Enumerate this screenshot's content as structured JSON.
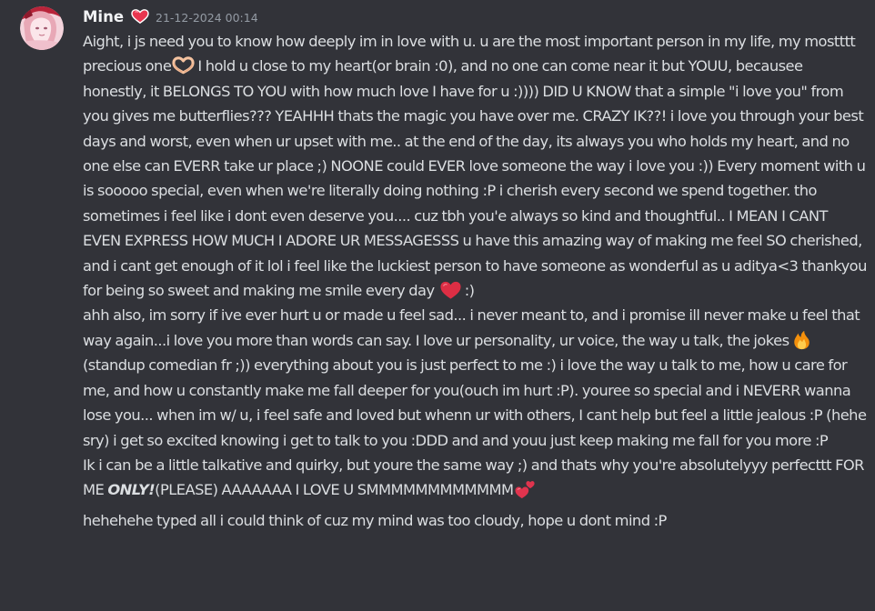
{
  "message": {
    "username": "Mine",
    "timestamp": "21-12-2024 00:14",
    "badge_icon": "red-heart-badge-icon",
    "colors": {
      "background": "#323339",
      "text": "#dbdee1",
      "username": "#f2f3f5",
      "timestamp": "#949ba4"
    },
    "p1": {
      "t1": "Aight, i js need you to know how deeply im in love with u. u are the most important person in my life, my mostttt precious one",
      "t2": "I hold u close to my heart(or brain :0), and no one can come near it but YOUU, becausee honestly, it BELONGS TO YOU with how much love I have for u :)))) DID U KNOW that a simple \"i love you\" from you gives me butterflies??? YEAHHH thats the magic you have over me. CRAZY IK??! i love you through your best days and worst, even when ur upset with me.. at the end of the day, its always you who holds my heart, and no one else can EVERR take ur place ;)  NOONE could EVER love someone the way i love you :)) Every moment with u is sooooo special, even when we're literally doing nothing :P i cherish every second we spend together. tho sometimes i feel like i dont even deserve you.... cuz tbh you'e always so kind and thoughtful.. I MEAN I CANT EVEN EXPRESS HOW MUCH I ADORE UR MESSAGESSS u have this amazing way of making me feel SO cherished, and i cant get enough of it lol i feel like the luckiest person to have someone as wonderful as u aditya<3 thankyou for being so sweet and making me smile every day",
      "t3": ":)"
    },
    "p2": {
      "t1": "ahh also, im sorry if ive ever hurt u or made u feel sad... i never meant to, and i promise ill never make u feel that way again...i love you more than words can say. I love ur personality, ur voice, the way u talk, the jokes",
      "t2": "(standup comedian fr ;)) everything about you is just perfect to me :) i love the way u talk to me, how u care for me, and how u constantly make me fall deeper for you(ouch im hurt :P). youree so special and i NEVERR wanna lose you... when im w/ u, i feel safe and loved but whenn ur with others, I cant help but feel a little jealous :P (hehe sry) i get so excited knowing i get to talk to you :DDD and and youu just keep making me fall for you more :P"
    },
    "p3": {
      "t1": "Ik i can be a little talkative and quirky, but youre the same way ;) and thats why you're absolutelyyy perfecttt FOR ME ",
      "t2": "ONLY!",
      "t3": "(PLEASE) AAAAAAA I LOVE U SMMMMMMMMMMMM"
    },
    "p4": {
      "t1": "hehehehe typed all i could think of cuz my mind was too cloudy, hope u dont mind :P"
    },
    "emojis": {
      "e1": "heart-hands-icon",
      "e2": "red-heart-icon",
      "e3": "fire-icon",
      "e4": "two-hearts-icon"
    }
  }
}
